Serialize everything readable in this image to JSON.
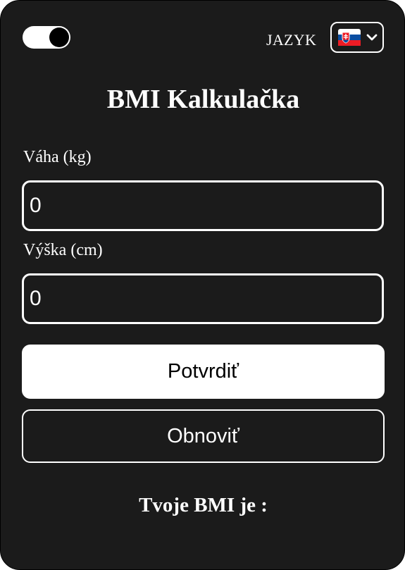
{
  "theme_toggle": {
    "state": "on",
    "icon": "toggle-switch"
  },
  "language": {
    "label": "JAZYK",
    "selected": "SK",
    "flag_icon": "slovakia-flag-icon",
    "chevron_icon": "chevron-down-icon"
  },
  "title": "BMI Kalkulačka",
  "weight": {
    "label": "Váha (kg)",
    "value": "0"
  },
  "height": {
    "label": "Výška (cm)",
    "value": "0"
  },
  "buttons": {
    "confirm_label": "Potvrdiť",
    "reset_label": "Obnoviť"
  },
  "result": {
    "label": "Tvoje BMI je :"
  },
  "colors": {
    "background": "#1b1b1b",
    "foreground": "#ffffff"
  }
}
